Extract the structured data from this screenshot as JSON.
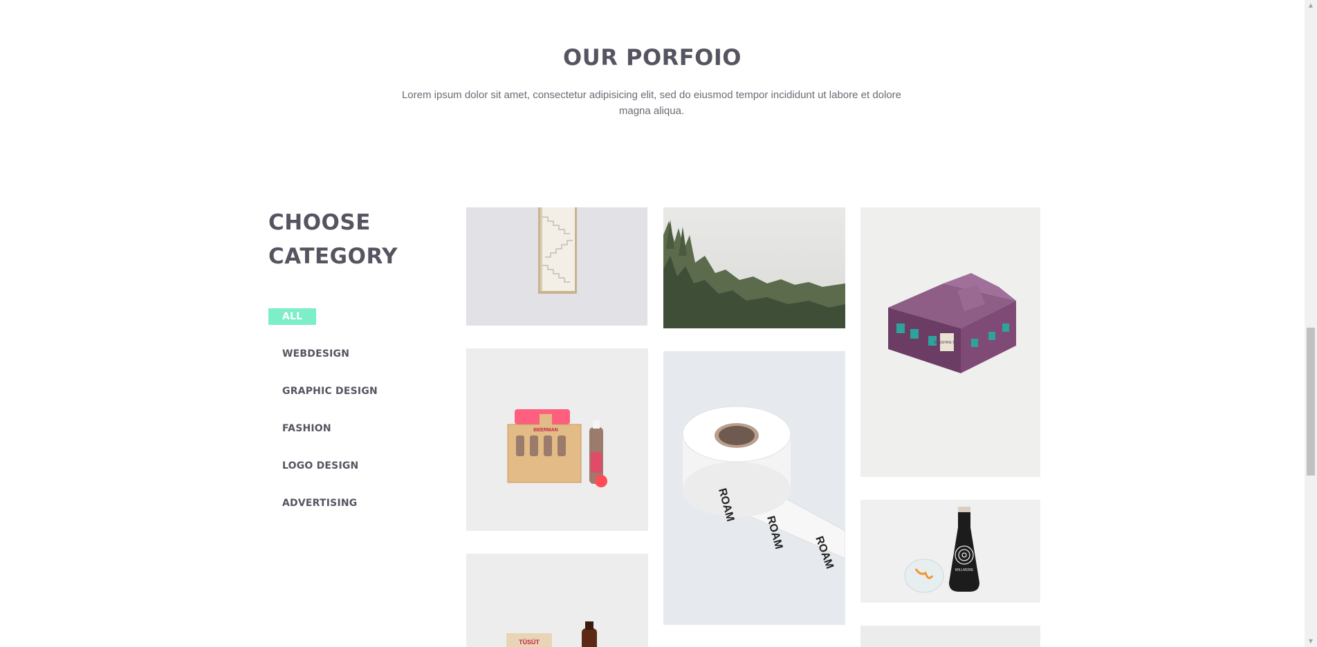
{
  "portfolio": {
    "title_highlight": "OUR",
    "title_rest": " PORFOIO",
    "description": "Lorem ipsum dolor sit amet, consectetur adipisicing elit, sed do eiusmod tempor incididunt ut labore et dolore magna aliqua."
  },
  "sidebar": {
    "title_line1": "CHOOSE",
    "title_line2": "CATEGORY",
    "categories": [
      "ALL",
      "WEBDESIGN",
      "GRAPHIC DESIGN",
      "FASHION",
      "LOGO DESIGN",
      "ADVERTISING"
    ],
    "active_category": "ALL"
  },
  "gallery": {
    "tile3_label": "SUNSHINE BOX",
    "tile4_label": "BEERMAN",
    "tile5_label": "ROAM",
    "tile6_label": "WILLMORE",
    "tile7_label": "TÜSÜT"
  },
  "colors": {
    "accent": "#7ceec8",
    "heading": "#555562",
    "text": "#6a6a75"
  },
  "icons": {
    "scroll_up": "triangle-up-icon",
    "scroll_down": "triangle-down-icon"
  }
}
